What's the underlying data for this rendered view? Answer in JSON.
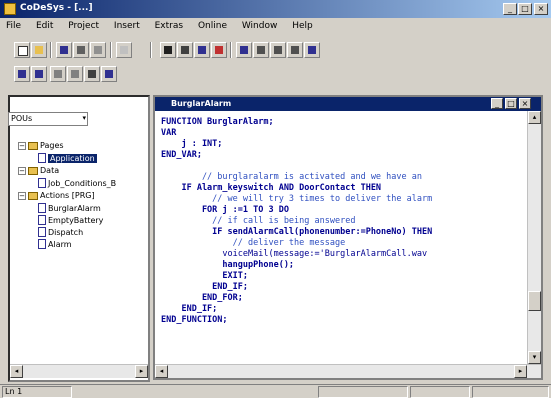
{
  "window": {
    "title": "CoDeSys - [...]"
  },
  "menu": [
    "File",
    "Edit",
    "Project",
    "Insert",
    "Extras",
    "Online",
    "Window",
    "Help"
  ],
  "tree": {
    "combo_value": "POUs",
    "nodes": [
      {
        "label": "Pages",
        "level": 0
      },
      {
        "label": "Application",
        "level": 1,
        "selected": true
      },
      {
        "label": "Data",
        "level": 0
      },
      {
        "label": "Job_Conditions_B",
        "level": 1
      },
      {
        "label": "Actions [PRG]",
        "level": 0
      },
      {
        "label": "BurglarAlarm",
        "level": 1
      },
      {
        "label": "EmptyBattery",
        "level": 1
      },
      {
        "label": "Dispatch",
        "level": 1
      },
      {
        "label": "Alarm",
        "level": 1
      }
    ]
  },
  "editor": {
    "title": "BurglarAlarm",
    "lines": [
      [
        {
          "t": "FUNCTION BurglarAlarm;",
          "c": "kw"
        }
      ],
      [
        {
          "t": "VAR",
          "c": "kw"
        }
      ],
      [
        {
          "t": "    j : INT;",
          "c": "kw"
        }
      ],
      [
        {
          "t": "END_VAR;",
          "c": "kw"
        }
      ],
      [
        {
          "t": "",
          "c": ""
        }
      ],
      [
        {
          "t": "        // burglaralarm is activated and we have an",
          "c": "cm"
        }
      ],
      [
        {
          "t": "    IF Alarm_keyswitch AND DoorContact THEN",
          "c": "kw"
        }
      ],
      [
        {
          "t": "          // we will try 3 times to deliver the alarm",
          "c": "cm"
        }
      ],
      [
        {
          "t": "        FOR j :=1 TO 3 DO",
          "c": "kw"
        }
      ],
      [
        {
          "t": "          // if call is being answered",
          "c": "cm"
        }
      ],
      [
        {
          "t": "          IF sendAlarmCall(phonenumber:=PhoneNo) THEN",
          "c": "kw"
        }
      ],
      [
        {
          "t": "              // deliver the message",
          "c": "cm"
        }
      ],
      [
        {
          "t": "            voiceMail(message:='BurglarAlarmCall.wav",
          "c": "str"
        }
      ],
      [
        {
          "t": "            hangupPhone();",
          "c": "kw"
        }
      ],
      [
        {
          "t": "            EXIT;",
          "c": "kw"
        }
      ],
      [
        {
          "t": "          END_IF;",
          "c": "kw"
        }
      ],
      [
        {
          "t": "        END_FOR;",
          "c": "kw"
        }
      ],
      [
        {
          "t": "    END_IF;",
          "c": "kw"
        }
      ],
      [
        {
          "t": "END_FUNCTION;",
          "c": "kw"
        }
      ]
    ]
  },
  "status": {
    "left": "Ln 1",
    "mid": "",
    "right": ""
  },
  "colors": {
    "title_bar": "#0a246a",
    "keyword": "#000090",
    "comment": "#3050c0"
  }
}
